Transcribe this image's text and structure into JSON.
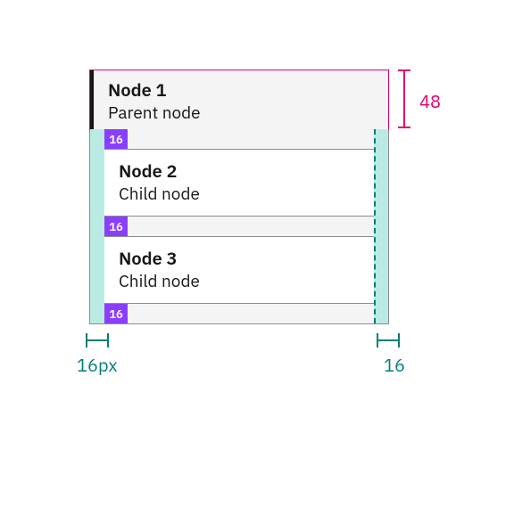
{
  "colors": {
    "magenta": "#e5006d",
    "teal": "#007d79",
    "purple": "#8a3ffc",
    "lightTeal": "#b9ebe4",
    "panelGrey": "#f4f4f4",
    "border": "#8d8d8d"
  },
  "parent": {
    "title": "Node 1",
    "subtitle": "Parent node"
  },
  "children": [
    {
      "title": "Node 2",
      "subtitle": "Child node"
    },
    {
      "title": "Node 3",
      "subtitle": "Child node"
    }
  ],
  "spacing": {
    "vertical_gap_px": "16",
    "row_height_label": "48",
    "left_padding_label": "16px",
    "right_padding_label": "16"
  }
}
